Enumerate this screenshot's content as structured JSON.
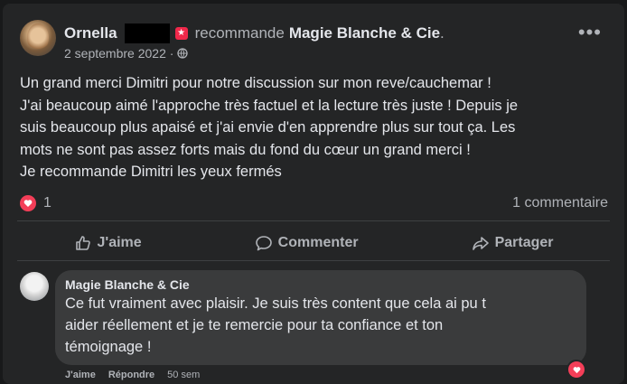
{
  "post": {
    "author": "Ornella",
    "verb": "recommande",
    "page": "Magie Blanche & Cie",
    "trailing_dot": ".",
    "date": "2 septembre 2022 ·",
    "badge_icon": "★",
    "more_icon": "•••",
    "lines": [
      "Un grand merci Dimitri pour notre discussion sur mon reve/cauchemar !",
      "J'ai beaucoup aimé l'approche très factuel et la lecture très juste ! Depuis je",
      "suis beaucoup plus apaisé et j'ai envie d'en apprendre plus sur tout ça. Les",
      "mots ne sont pas assez forts mais du fond du cœur un grand merci !",
      "Je recommande Dimitri les yeux fermés"
    ],
    "reaction_count": "1",
    "comment_count": "1 commentaire"
  },
  "actions": {
    "like": "J'aime",
    "comment": "Commenter",
    "share": "Partager"
  },
  "reply": {
    "author": "Magie Blanche & Cie",
    "lines": [
      "Ce fut vraiment avec plaisir. Je suis très content que cela ai pu t",
      "aider réellement et je te remercie pour ta confiance et ton",
      "témoignage !"
    ],
    "like": "J'aime",
    "respond": "Répondre",
    "time": "50 sem"
  },
  "colors": {
    "background": "#18191a",
    "card": "#242526",
    "bubble": "#3a3b3c",
    "text": "#e4e6eb",
    "secondary": "#b0b3b8",
    "heart": "#f33e58",
    "badge": "#f0284a"
  }
}
